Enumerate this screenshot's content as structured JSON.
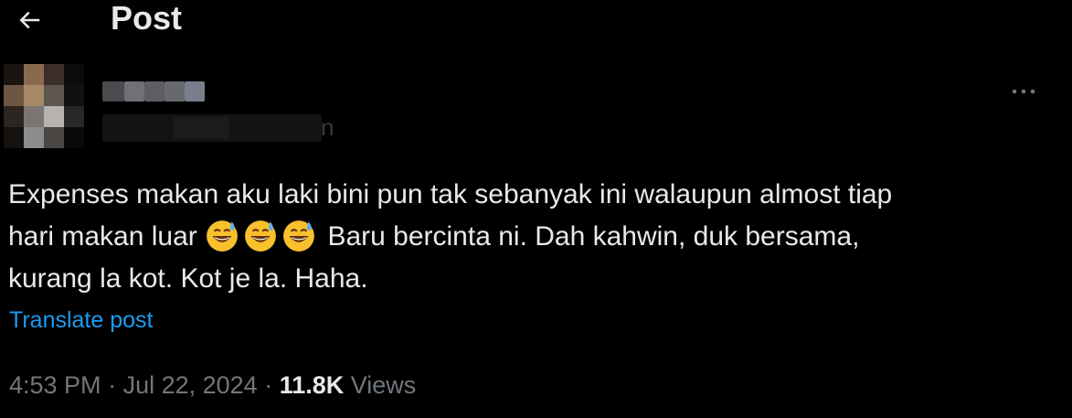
{
  "header": {
    "title": "Post",
    "back_icon": "arrow-left-icon"
  },
  "author": {
    "avatar": "pixelated-avatar",
    "name_visible_fragment": "n"
  },
  "post": {
    "text_line1": "Expenses makan aku laki bini pun tak sebanyak ini walaupun almost tiap",
    "text_line2_a": "hari makan luar",
    "text_line2_b": " Baru bercinta ni. Dah kahwin, duk bersama,",
    "text_line3": "kurang la kot. Kot je la. Haha.",
    "emoji": "grinning-face-with-sweat",
    "emoji_count": 3
  },
  "translate_label": "Translate post",
  "meta": {
    "time": "4:53 PM",
    "sep1": " · ",
    "date": "Jul 22, 2024",
    "sep2": " · ",
    "views_count": "11.8K",
    "views_label": " Views"
  },
  "more_icon": "more-dots-icon",
  "colors": {
    "background": "#000000",
    "text": "#e7e9ea",
    "muted": "#71767b",
    "link": "#1d9bf0"
  }
}
